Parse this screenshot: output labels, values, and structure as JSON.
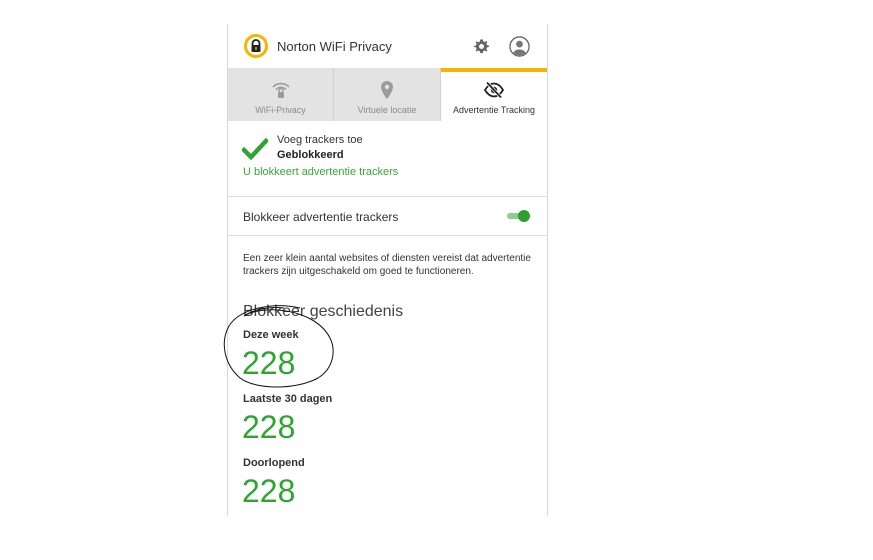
{
  "app": {
    "title": "Norton WiFi Privacy"
  },
  "header": {
    "settings_icon": "gear-icon",
    "account_icon": "account-icon",
    "logo_icon": "norton-lock-logo"
  },
  "tabs": [
    {
      "label": "WiFi-Privacy",
      "icon": "wifi-lock-icon",
      "active": false
    },
    {
      "label": "Virtuele locatie",
      "icon": "location-pin-icon",
      "active": false
    },
    {
      "label": "Advertentie Tracking",
      "icon": "eye-slash-icon",
      "active": true
    }
  ],
  "status": {
    "line1": "Voeg trackers toe",
    "line2": "Geblokkeerd",
    "link": "U blokkeert advertentie trackers",
    "icon": "checkmark-icon"
  },
  "toggle": {
    "label": "Blokkeer advertentie trackers",
    "enabled": true
  },
  "info": {
    "text": "Een zeer klein aantal websites of diensten vereist dat advertentie trackers zijn uitgeschakeld om goed te functioneren."
  },
  "history": {
    "title": "Blokkeer geschiedenis",
    "stats": [
      {
        "label": "Deze week",
        "value": "228"
      },
      {
        "label": "Laatste 30 dagen",
        "value": "228"
      },
      {
        "label": "Doorlopend",
        "value": "228"
      }
    ]
  },
  "colors": {
    "accent_yellow": "#f2b600",
    "green": "#2ea52e",
    "link_green": "#36a836",
    "tab_inactive": "#e3e3e3"
  }
}
